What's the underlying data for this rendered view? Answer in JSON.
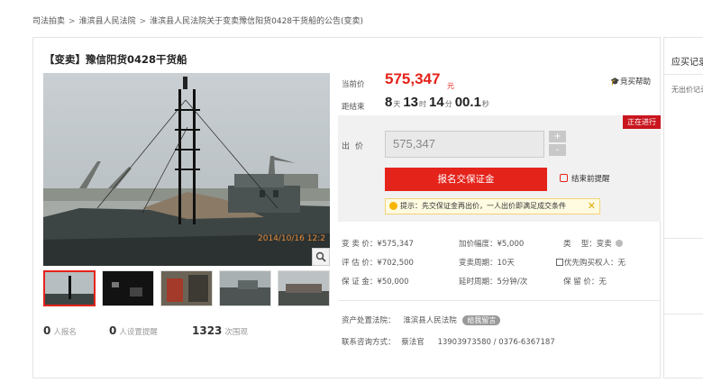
{
  "breadcrumb": {
    "items": [
      "司法拍卖",
      "淮滨县人民法院",
      "淮滨县人民法院关于变卖豫信阳货0428干货船的公告(变卖)"
    ],
    "sep": ">"
  },
  "title": "【变卖】豫信阳货0428干货船",
  "photo": {
    "timestamp": "2014/10/16  12:2"
  },
  "stats": {
    "signup_count": "0",
    "signup_label": "人报名",
    "reminder_count": "0",
    "reminder_label": "人设置提醒",
    "view_count": "1323",
    "view_label": "次围观"
  },
  "price": {
    "label": "当前价",
    "value": "575,347",
    "unit": "元",
    "help": "竞买帮助"
  },
  "countdown": {
    "label": "距结束",
    "days": "8",
    "days_unit": "天",
    "hours": "13",
    "hours_unit": "时",
    "minutes": "14",
    "minutes_unit": "分",
    "seconds": "00.1",
    "seconds_unit": "秒"
  },
  "bid": {
    "status": "正在进行",
    "label": "出价",
    "input_value": "575,347",
    "plus": "+",
    "minus": "-",
    "deposit_button": "报名交保证金",
    "remind": "结束前提醒",
    "tip": "提示：先交保证金再出价，一人出价即满足成交条件",
    "tip_close": "✕"
  },
  "info": {
    "sale_price_label": "变 卖 价：",
    "sale_price": "¥575,347",
    "increment_label": "加价幅度：",
    "increment": "¥5,000",
    "type_label": "类　 型：",
    "type": "变卖",
    "valuation_label": "评 估 价：",
    "valuation": "¥702,500",
    "cycle_label": "变卖周期：",
    "cycle": "10天",
    "priority_label": "优先购买权人：",
    "priority": "无",
    "deposit_label": "保 证 金：",
    "deposit": "¥50,000",
    "delay_label": "延时周期：",
    "delay": "5分钟/次",
    "reserve_label": "保 留 价：",
    "reserve": "无"
  },
  "court": {
    "label": "资产处置法院：",
    "name": "淮滨县人民法院",
    "message": "给我留言"
  },
  "contact": {
    "label": "联系咨询方式：",
    "name": "蔡法官",
    "phone": "13903973580 / 0376-6367187"
  },
  "side": {
    "title": "应买记录",
    "empty": "无出价记录"
  },
  "colors": {
    "accent": "#e4231b",
    "badge": "#c9151e"
  }
}
